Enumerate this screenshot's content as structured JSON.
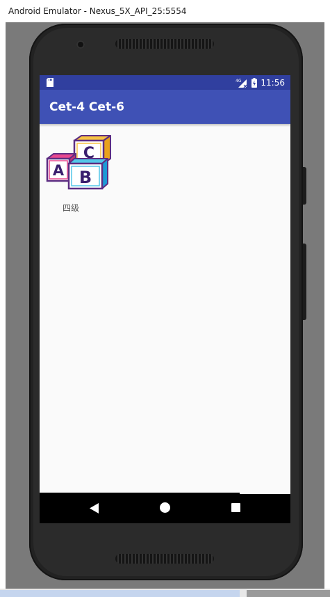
{
  "window": {
    "title": "Android Emulator - Nexus_5X_API_25:5554"
  },
  "status_bar": {
    "time": "11:56",
    "network": "4G",
    "icons": [
      "sd-card-icon",
      "signal-icon",
      "battery-icon"
    ]
  },
  "toolbar": {
    "title": "Cet-4 Cet-6"
  },
  "grid": {
    "items": [
      {
        "label": "四级",
        "icon": "abc-blocks-icon"
      }
    ]
  },
  "nav_bar": {
    "icons": [
      "back-icon",
      "home-icon",
      "recents-icon"
    ]
  },
  "colors": {
    "status_bar": "#303f9f",
    "toolbar": "#3f51b5",
    "background": "#fafafa"
  }
}
